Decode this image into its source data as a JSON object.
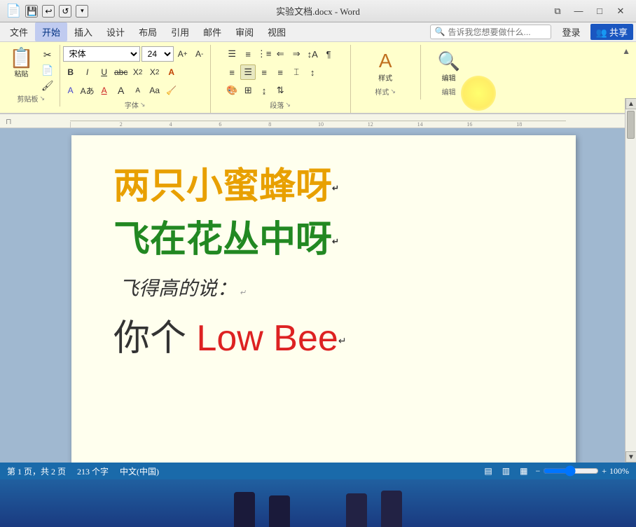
{
  "titleBar": {
    "title": "实验文档.docx - Word",
    "appIcon": "📄",
    "quickAccess": [
      "💾",
      "↩",
      "↺",
      "▾"
    ],
    "winControls": {
      "minimize": "—",
      "maximize": "□",
      "close": "✕",
      "restore": "⧉"
    }
  },
  "menuBar": {
    "items": [
      "文件",
      "开始",
      "插入",
      "设计",
      "布局",
      "引用",
      "邮件",
      "审阅",
      "视图"
    ],
    "activeItem": "开始",
    "search": {
      "placeholder": "告诉我您想要做什么...",
      "icon": "🔍"
    },
    "userActions": [
      "登录",
      "共享"
    ]
  },
  "ribbon": {
    "groups": [
      {
        "name": "剪贴板",
        "label": "剪贴板",
        "expandIcon": "↘"
      },
      {
        "name": "字体",
        "label": "字体",
        "fontName": "宋体",
        "fontSize": "24",
        "expandIcon": "↘"
      },
      {
        "name": "段落",
        "label": "段落",
        "expandIcon": "↘"
      },
      {
        "name": "样式",
        "label": "样式",
        "expandIcon": "↘"
      },
      {
        "name": "编辑",
        "label": "编辑"
      }
    ]
  },
  "document": {
    "line1": "两只小蜜蜂呀",
    "line1Color": "#e8a000",
    "line2": "飞在花丛中呀",
    "line2Color": "#228822",
    "line3": "飞得高的说：",
    "line3Color": "#333333",
    "line4prefix": "你个 ",
    "line4red": "Low Bee",
    "line4Color": "#333333",
    "line4RedColor": "#dd2222"
  },
  "statusBar": {
    "page": "第 1 页，共 2 页",
    "wordCount": "213 个字",
    "language": "中文(中国)",
    "viewIcons": [
      "▤",
      "▥",
      "▦"
    ],
    "zoomLevel": "100%",
    "zoomMinus": "−",
    "zoomPlus": "+"
  }
}
